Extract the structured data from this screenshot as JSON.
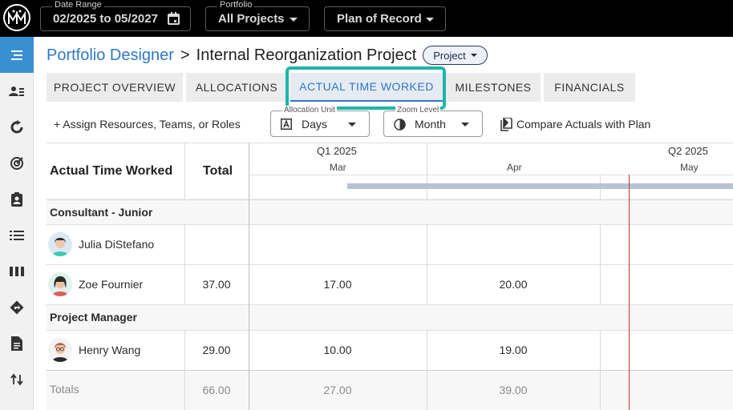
{
  "topbar": {
    "logo": "MM",
    "date_range": {
      "label": "Date Range",
      "value": "02/2025 to 05/2027"
    },
    "portfolio": {
      "label": "Portfolio",
      "value": "All Projects"
    },
    "plan": {
      "value": "Plan of Record"
    }
  },
  "sidebar": {
    "items": [
      "menu-icon",
      "people-list-icon",
      "cycle-icon",
      "target-icon",
      "clipboard-icon",
      "list-icon",
      "columns-icon",
      "direction-icon",
      "document-icon",
      "sort-arrows-icon"
    ]
  },
  "header": {
    "breadcrumb_link": "Portfolio Designer",
    "separator": ">",
    "title": "Internal Reorganization Project",
    "chip": "Project"
  },
  "tabs": [
    "PROJECT OVERVIEW",
    "ALLOCATIONS",
    "ACTUAL TIME WORKED",
    "MILESTONES",
    "FINANCIALS"
  ],
  "toolbar": {
    "assign": "+ Assign Resources, Teams, or Roles",
    "allocation_unit": {
      "label": "Allocation Unit",
      "value": "Days"
    },
    "zoom_level": {
      "label": "Zoom Level",
      "value": "Month"
    },
    "compare": "Compare Actuals with Plan"
  },
  "table": {
    "col_title": "Actual Time Worked",
    "col_total": "Total",
    "q1": "Q1 2025",
    "q2": "Q2 2025",
    "months": [
      "Mar",
      "Apr",
      "May"
    ],
    "group1": "Consultant - Junior",
    "group2": "Project Manager",
    "rows": [
      {
        "name": "Julia DiStefano",
        "total": "",
        "mar": "",
        "apr": ""
      },
      {
        "name": "Zoe Fournier",
        "total": "37.00",
        "mar": "17.00",
        "apr": "20.00"
      },
      {
        "name": "Henry Wang",
        "total": "29.00",
        "mar": "10.00",
        "apr": "19.00"
      }
    ],
    "totals": {
      "label": "Totals",
      "total": "66.00",
      "mar": "27.00",
      "apr": "39.00"
    }
  },
  "colors": {
    "accent": "#2f78c4",
    "highlight": "#1fb5a8",
    "today_line": "#c0392b",
    "sidebar_active": "#3a8fd0"
  }
}
